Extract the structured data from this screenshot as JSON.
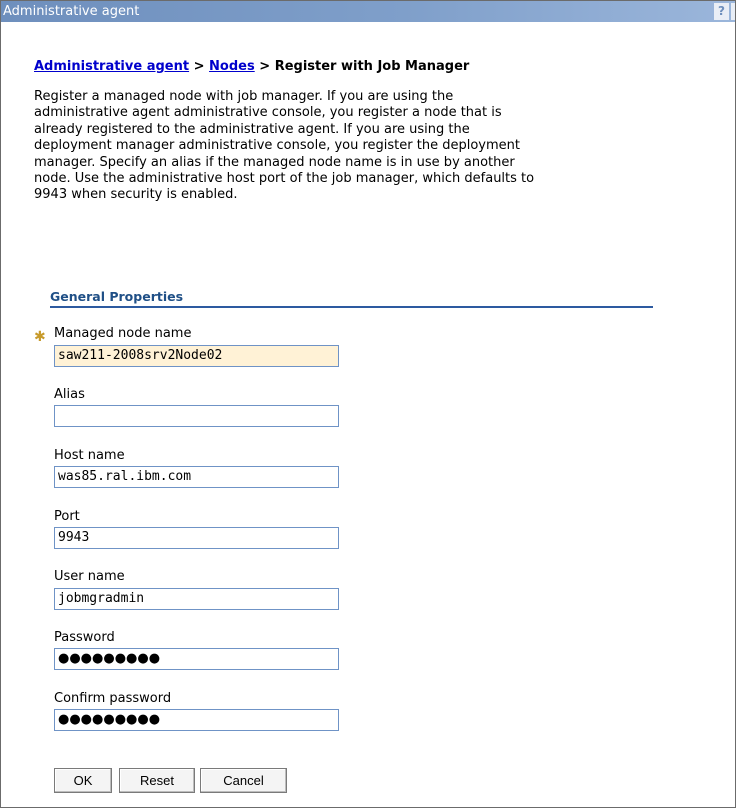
{
  "window": {
    "title": "Administrative agent",
    "help_label": "?"
  },
  "breadcrumb": {
    "item1": "Administrative agent",
    "sep1": ">",
    "item2": "Nodes",
    "sep2": ">",
    "current": "Register with Job Manager"
  },
  "description": "Register a managed node with job manager. If you are using the\nadministrative agent administrative console, you register a node that is\nalready registered to the administrative agent. If you are using the\ndeployment manager administrative console, you register the deployment\nmanager. Specify an alias if the managed node name is in use by another\nnode. Use the administrative host port of the job manager, which defaults to\n9943 when security is enabled.",
  "section": {
    "title": "General Properties"
  },
  "form": {
    "required_marker": "✱",
    "managed_node_name": {
      "label": "Managed node name",
      "value": "saw211-2008srv2Node02"
    },
    "alias": {
      "label": "Alias",
      "value": ""
    },
    "host_name": {
      "label": "Host name",
      "value": "was85.ral.ibm.com"
    },
    "port": {
      "label": "Port",
      "value": "9943"
    },
    "user_name": {
      "label": "User name",
      "value": "jobmgradmin"
    },
    "password": {
      "label": "Password",
      "value": "●●●●●●●●●"
    },
    "confirm_password": {
      "label": "Confirm password",
      "value": "●●●●●●●●●"
    }
  },
  "buttons": {
    "ok": "OK",
    "reset": "Reset",
    "cancel": "Cancel"
  },
  "colors": {
    "title_bar": "#7f9fca",
    "link": "#0000cc",
    "section_title": "#1f4f86",
    "field_border": "#6f93c6",
    "highlight_field": "#fff2d6",
    "required": "#c79a2b"
  }
}
